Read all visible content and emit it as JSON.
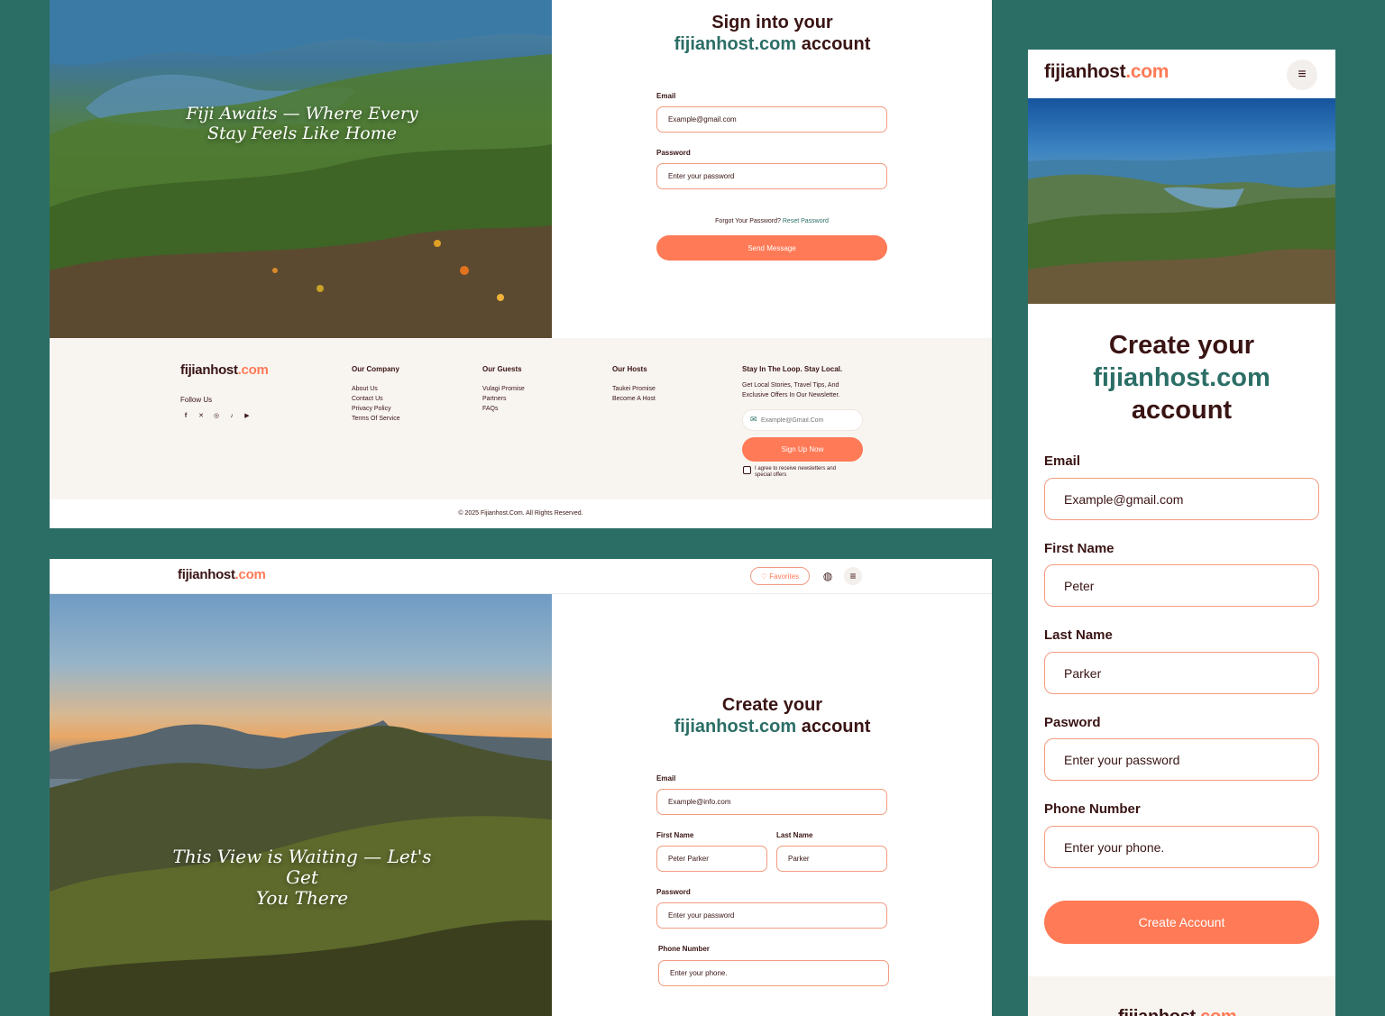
{
  "brand": {
    "name_main": "fijianhost",
    "name_suffix": ".com",
    "domain": "fijianhost.com"
  },
  "colors": {
    "background": "#2b6e66",
    "accent": "#ff7a56",
    "brand_teal": "#2b6e66",
    "text_dark": "#3a1414",
    "footer_bg": "#f8f5f1"
  },
  "signin": {
    "hero_caption_line1": "Fiji Awaits — Where Every",
    "hero_caption_line2": "Stay Feels Like Home",
    "title_line1": "Sign into your",
    "title_account": " account",
    "email_label": "Email",
    "email_placeholder": "Example@gmail.com",
    "password_label": "Password",
    "password_placeholder": "Enter your password",
    "forgot_text": "Forgot Your Password?",
    "reset_link": "Reset Password",
    "submit_label": "Send Message"
  },
  "footer": {
    "follow_us": "Follow Us",
    "social_icons": [
      "facebook-icon",
      "x-icon",
      "instagram-icon",
      "tiktok-icon",
      "youtube-icon"
    ],
    "company": {
      "title": "Our Company",
      "links": [
        "About Us",
        "Contact Us",
        "Privacy Policy",
        "Terms Of Service"
      ]
    },
    "guests": {
      "title": "Our Guests",
      "links": [
        "Vulagi Promise",
        "Partners",
        "FAQs"
      ]
    },
    "hosts": {
      "title": "Our Hosts",
      "links": [
        "Taukei Promise",
        "Become A Host"
      ]
    },
    "newsletter": {
      "title": "Stay In The Loop. Stay Local.",
      "description_line1": "Get Local Stories, Travel Tips, And",
      "description_line2": "Exclusive Offers In Our Newsletter.",
      "email_placeholder": "Example@Gmail.Com",
      "button_label": "Sign Up Now",
      "consent_line1": "I agree to receive newsletters and",
      "consent_line2": "special offers"
    },
    "copyright": "© 2025  Fijianhost.Com. All Rights Reserved."
  },
  "signup": {
    "nav_favorites": "Favorites",
    "hero_caption_line1": "This View is Waiting — Let's Get",
    "hero_caption_line2": "You There",
    "title_line1": "Create your",
    "title_account": " account",
    "email_label": "Email",
    "email_placeholder": "Example@info.com",
    "first_name_label": "First Name",
    "first_name_value": "Peter Parker",
    "last_name_label": "Last Name",
    "last_name_value": "Parker",
    "password_label": "Password",
    "password_placeholder": "Enter your password",
    "phone_label": "Phone Number",
    "phone_placeholder": "Enter your phone."
  },
  "mobile": {
    "title_line1": "Create your",
    "title_line3": "account",
    "email_label": "Email",
    "email_placeholder": "Example@gmail.com",
    "first_name_label": "First Name",
    "first_name_value": "Peter",
    "last_name_label": "Last Name",
    "last_name_value": "Parker",
    "password_label": "Pasword",
    "password_placeholder": "Enter your password",
    "phone_label": "Phone Number",
    "phone_placeholder": "Enter your phone.",
    "submit_label": "Create Account"
  }
}
